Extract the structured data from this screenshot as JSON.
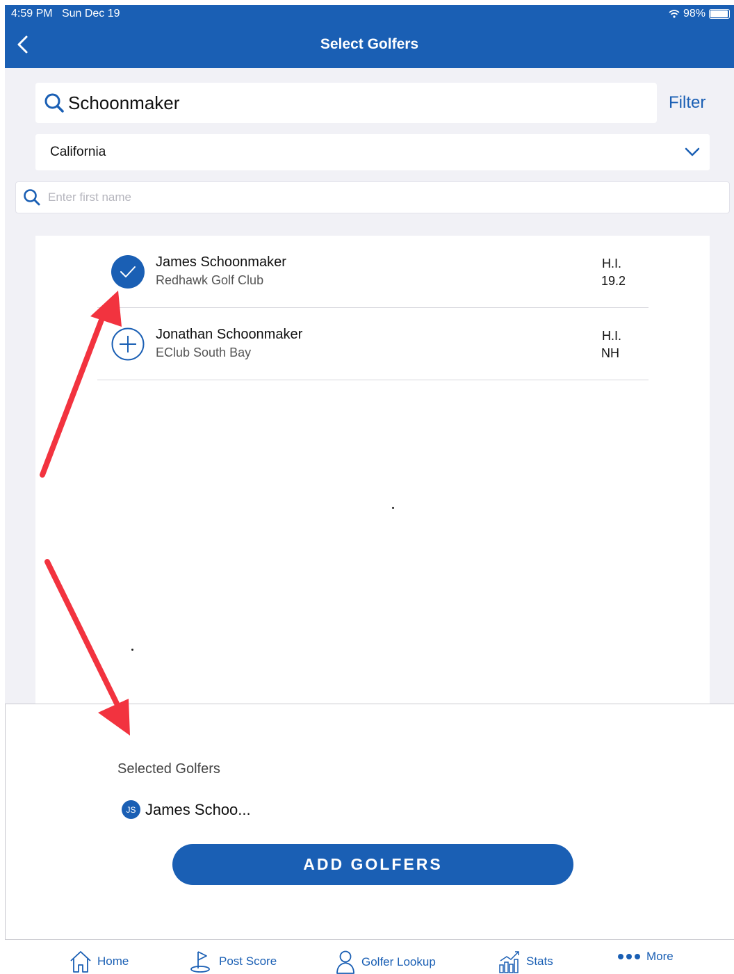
{
  "status_bar": {
    "time": "4:59 PM",
    "date": "Sun Dec 19",
    "battery": "98%",
    "battery_level": 0.98
  },
  "header": {
    "title": "Select Golfers"
  },
  "search": {
    "value": "Schoonmaker",
    "filter_label": "Filter"
  },
  "state_select": {
    "value": "California"
  },
  "name_search": {
    "placeholder": "Enter first name"
  },
  "golfers": [
    {
      "name": "James Schoonmaker",
      "club": "Redhawk Golf Club",
      "hi_label": "H.I.",
      "hi_value": "19.2",
      "selected": true
    },
    {
      "name": "Jonathan Schoonmaker",
      "club": "EClub South Bay",
      "hi_label": "H.I.",
      "hi_value": "NH",
      "selected": false
    }
  ],
  "selected": {
    "heading": "Selected Golfers",
    "chips": [
      {
        "initials": "JS",
        "name": "James Schoo..."
      }
    ]
  },
  "add_button": {
    "label": "ADD GOLFERS"
  },
  "tabs": [
    {
      "label": "Home",
      "icon": "home-icon"
    },
    {
      "label": "Post Score",
      "icon": "golf-flag-icon"
    },
    {
      "label": "Golfer Lookup",
      "icon": "person-icon"
    },
    {
      "label": "Stats",
      "icon": "chart-icon"
    },
    {
      "label": "More",
      "icon": "more-dots-icon"
    }
  ],
  "colors": {
    "primary": "#1a5fb4",
    "background": "#f1f1f6",
    "annotation": "#f2333f"
  }
}
